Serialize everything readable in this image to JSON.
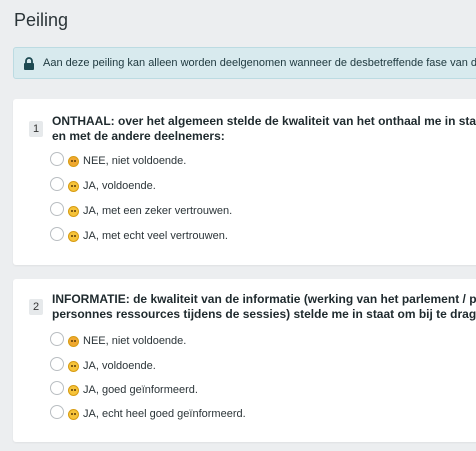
{
  "page": {
    "title": "Peiling"
  },
  "notice": {
    "icon": "lock-icon",
    "text": "Aan deze peiling kan alleen worden deelgenomen wanneer de desbetreffende fase van d"
  },
  "questions": [
    {
      "number": "1",
      "line1": "ONTHAAL: over het algemeen stelde de kwaliteit van het onthaal me in staat",
      "line2": "en met de andere deelnemers:",
      "options": [
        {
          "emoji": "angry-face-icon",
          "label": "NEE, niet voldoende."
        },
        {
          "emoji": "slight-smile-icon",
          "label": "JA, voldoende."
        },
        {
          "emoji": "smile-icon",
          "label": "JA, met een zeker vertrouwen."
        },
        {
          "emoji": "big-smile-icon",
          "label": "JA, met echt veel vertrouwen."
        }
      ]
    },
    {
      "number": "2",
      "line1": "INFORMATIE: de kwaliteit van de informatie (werking van het parlement / pr",
      "line2": "personnes ressources tijdens de sessies) stelde me in staat om bij te drager",
      "options": [
        {
          "emoji": "angry-face-icon",
          "label": "NEE, niet voldoende."
        },
        {
          "emoji": "slight-smile-icon",
          "label": "JA, voldoende."
        },
        {
          "emoji": "smile-icon",
          "label": "JA, goed geïnformeerd."
        },
        {
          "emoji": "big-smile-icon",
          "label": "JA, echt heel goed geïnformeerd."
        }
      ]
    }
  ]
}
